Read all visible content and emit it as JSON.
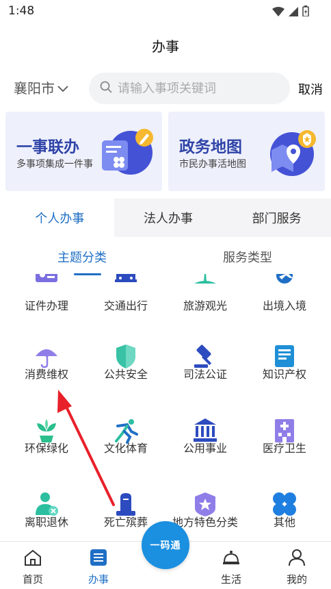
{
  "status_bar": {
    "time": "1:48"
  },
  "header": {
    "title": "办事"
  },
  "search": {
    "city": "襄阳市",
    "placeholder": "请输入事项关键词",
    "cancel_label": "取消"
  },
  "banner_cards": [
    {
      "title": "一事联办",
      "subtitle": "多事项集成一件事"
    },
    {
      "title": "政务地图",
      "subtitle": "市民办事活地图"
    }
  ],
  "tabs": [
    {
      "label": "个人办事",
      "active": true
    },
    {
      "label": "法人办事",
      "active": false
    },
    {
      "label": "部门服务",
      "active": false
    }
  ],
  "subtabs": [
    {
      "label": "主题分类",
      "active": true
    },
    {
      "label": "服务类型",
      "active": false
    }
  ],
  "categories": [
    {
      "label": "证件办理",
      "icon": "id-card-icon"
    },
    {
      "label": "交通出行",
      "icon": "train-icon"
    },
    {
      "label": "旅游观光",
      "icon": "island-icon"
    },
    {
      "label": "出境入境",
      "icon": "plane-icon"
    },
    {
      "label": "消费维权",
      "icon": "umbrella-icon"
    },
    {
      "label": "公共安全",
      "icon": "shield-icon"
    },
    {
      "label": "司法公证",
      "icon": "gavel-icon"
    },
    {
      "label": "知识产权",
      "icon": "book-icon"
    },
    {
      "label": "环保绿化",
      "icon": "plant-icon"
    },
    {
      "label": "文化体育",
      "icon": "runner-icon"
    },
    {
      "label": "公用事业",
      "icon": "building-icon"
    },
    {
      "label": "医疗卫生",
      "icon": "hospital-icon"
    },
    {
      "label": "离职退休",
      "icon": "retire-icon"
    },
    {
      "label": "死亡殡葬",
      "icon": "tombstone-icon"
    },
    {
      "label": "地方特色分类",
      "icon": "badge-star-icon"
    },
    {
      "label": "其他",
      "icon": "four-leaf-icon"
    }
  ],
  "bottom_nav": [
    {
      "label": "首页",
      "icon": "home-icon",
      "active": false
    },
    {
      "label": "办事",
      "icon": "list-icon",
      "active": true
    },
    {
      "label": "一码通",
      "icon": "qr-pass-icon",
      "active": false
    },
    {
      "label": "生活",
      "icon": "bell-service-icon",
      "active": false
    },
    {
      "label": "我的",
      "icon": "user-icon",
      "active": false
    }
  ],
  "colors": {
    "accent": "#1f6fc5",
    "card_bg": "#eef0fb",
    "card_title": "#2f44a8",
    "annotation_arrow": "#e8202a"
  }
}
